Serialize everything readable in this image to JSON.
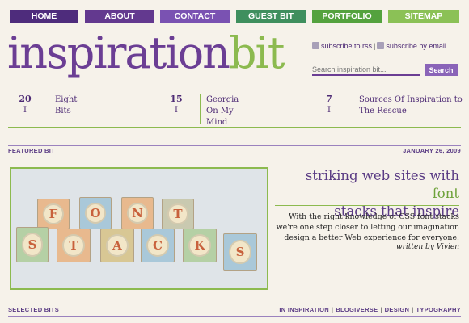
{
  "nav": {
    "items": [
      {
        "label": "HOME"
      },
      {
        "label": "ABOUT"
      },
      {
        "label": "CONTACT"
      },
      {
        "label": "GUEST BIT"
      },
      {
        "label": "PORTFOLIO"
      },
      {
        "label": "SITEMAP"
      }
    ]
  },
  "logo": {
    "part1": "inspiration",
    "part2": "bit"
  },
  "subscribe": {
    "rss": "subscribe to rss",
    "email": "subscribe by email",
    "separator": "|"
  },
  "search": {
    "placeholder": "Search inspiration bit...",
    "button": "Search"
  },
  "recent_posts": [
    {
      "day": "20",
      "month": "I",
      "title": "Eight Bits"
    },
    {
      "day": "15",
      "month": "I",
      "title": "Georgia On My Mind"
    },
    {
      "day": "7",
      "month": "I",
      "title": "Sources Of Inspiration to The Rescue"
    }
  ],
  "featured": {
    "section_label": "FEATURED BIT",
    "date": "JANUARY 26, 2009",
    "title_part1": "striking web sites with ",
    "title_part2": "font",
    "title_line2": "stacks that inspire",
    "description": "With the right knowledge of CSS font stacks we're one step closer to letting our imagination design a better Web experience for everyone.",
    "author": "written by Vivien",
    "blocks_word1": [
      "F",
      "O",
      "N",
      "T"
    ],
    "blocks_word2": [
      "S",
      "T",
      "A",
      "C",
      "K",
      "S"
    ]
  },
  "selected": {
    "section_label": "SELECTED BITS",
    "categories": [
      "IN INSPIRATION",
      "BLOGIVERSE",
      "DESIGN",
      "TYPOGRAPHY"
    ]
  },
  "colors": {
    "purple": "#6b3e94",
    "green": "#8cba4f",
    "background": "#f6f2ea"
  }
}
